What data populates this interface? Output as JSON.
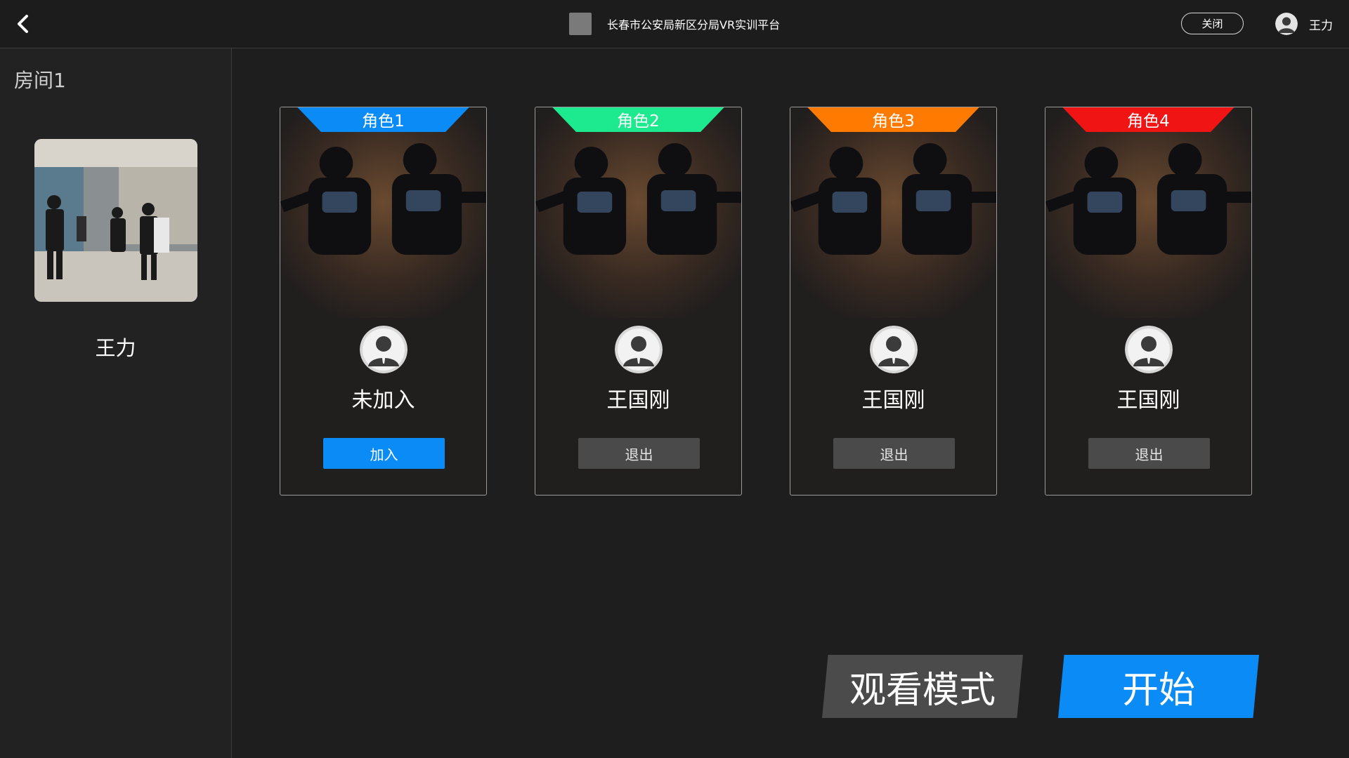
{
  "header": {
    "app_title": "长春市公安局新区分局VR实训平台",
    "close_label": "关闭",
    "user_name": "王力"
  },
  "sidebar": {
    "room_title": "房间1",
    "user_name": "王力"
  },
  "roles": [
    {
      "label": "角色1",
      "player": "未加入",
      "button": "加入",
      "color": "#0a8bf5"
    },
    {
      "label": "角色2",
      "player": "王国刚",
      "button": "退出",
      "color": "#1de98f"
    },
    {
      "label": "角色3",
      "player": "王国刚",
      "button": "退出",
      "color": "#ff7a00"
    },
    {
      "label": "角色4",
      "player": "王国刚",
      "button": "退出",
      "color": "#f01414"
    }
  ],
  "actions": {
    "watch_mode": "观看模式",
    "start": "开始"
  },
  "colors": {
    "accent_blue": "#0a8bf5",
    "background": "#1f1e1e"
  }
}
